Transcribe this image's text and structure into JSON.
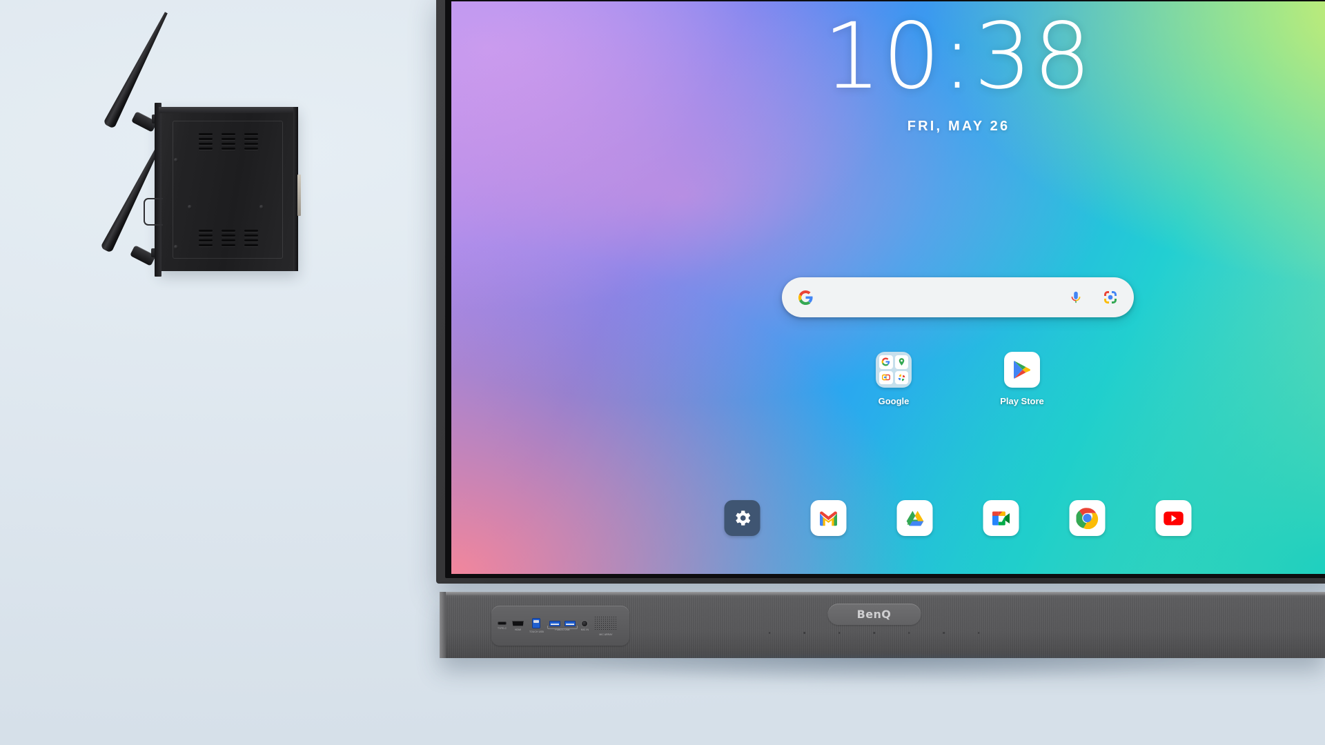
{
  "background": {
    "color": "#dde7ef"
  },
  "device": {
    "brand": "BenQ",
    "bezel_color": "#313133",
    "bottom_bar_color": "#58585a"
  },
  "wifi_module": {
    "name": "Wi-Fi / OPS module",
    "color": "#1d1d1f",
    "antenna_count": 2,
    "vent_groups": 2
  },
  "screen": {
    "wallpaper": {
      "type": "gradient",
      "colors": [
        "#c79cf0",
        "#5b7df0",
        "#2aa8ef",
        "#22cfd2",
        "#d7f06a",
        "#f2869c"
      ]
    },
    "clock": {
      "time": "10:38",
      "date": "FRI, MAY 26"
    },
    "search": {
      "placeholder": "",
      "value": "",
      "google_icon": "google-g-icon",
      "mic_icon": "microphone-icon",
      "lens_icon": "google-lens-camera-icon",
      "background": "#f1f3f4"
    },
    "apps": [
      {
        "label": "Google",
        "icon": "google-folder-icon",
        "type": "folder",
        "contents": [
          "google-search-icon",
          "google-maps-icon",
          "google-tv-icon",
          "google-photos-icon"
        ]
      },
      {
        "label": "Play Store",
        "icon": "play-store-icon",
        "type": "app"
      }
    ],
    "dock": [
      {
        "label": "Settings",
        "icon": "settings-gear-icon",
        "background": "#3f5572"
      },
      {
        "label": "Gmail",
        "icon": "gmail-icon",
        "background": "#ffffff"
      },
      {
        "label": "Drive",
        "icon": "google-drive-icon",
        "background": "#ffffff"
      },
      {
        "label": "Meet",
        "icon": "google-meet-icon",
        "background": "#ffffff"
      },
      {
        "label": "Chrome",
        "icon": "chrome-icon",
        "background": "#ffffff"
      },
      {
        "label": "YouTube",
        "icon": "youtube-icon",
        "background": "#ffffff"
      }
    ]
  },
  "ports": [
    {
      "label": "TYPE-C",
      "icon": "usb-c-port-icon"
    },
    {
      "label": "HDMI",
      "icon": "hdmi-port-icon"
    },
    {
      "label": "TOUCH USB",
      "icon": "usb-b-port-icon"
    },
    {
      "label": "PUBLIC USB",
      "icon": "usb-a-port-icon"
    },
    {
      "label": "PUBLIC USB",
      "icon": "usb-a-port-icon"
    },
    {
      "label": "MIC IN",
      "icon": "audio-jack-icon"
    },
    {
      "label": "MIC ARRAY",
      "icon": "microphone-grille-icon"
    }
  ]
}
